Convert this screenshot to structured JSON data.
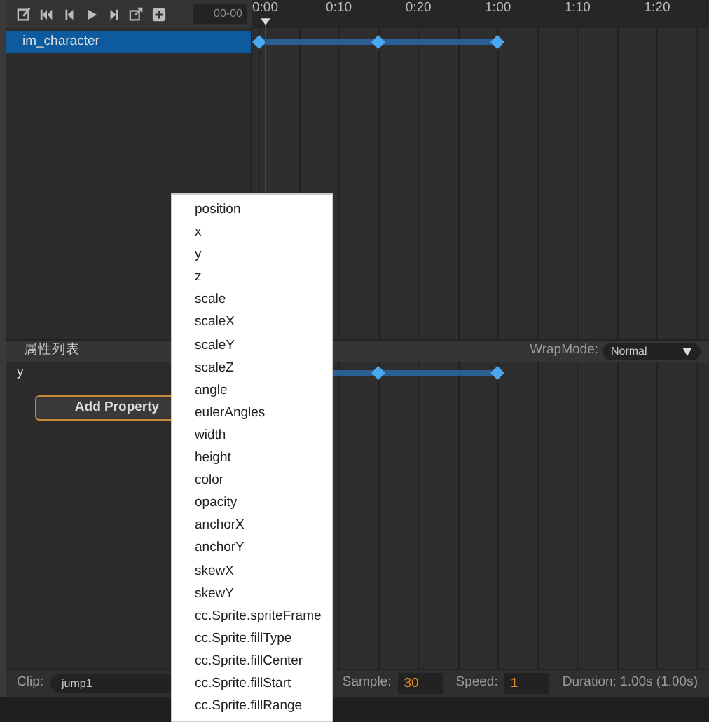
{
  "toolbar": {
    "time_field": "00-00"
  },
  "ruler": {
    "labels": [
      "0:00",
      "0:10",
      "0:20",
      "1:00",
      "1:10",
      "1:20"
    ]
  },
  "nodes": [
    {
      "name": "im_character",
      "selected": true
    }
  ],
  "property_panel": {
    "title": "属性列表",
    "wrap_mode_label": "WrapMode:",
    "wrap_mode_value": "Normal",
    "properties": [
      {
        "name": "y",
        "selected": false
      }
    ],
    "add_button": "Add Property"
  },
  "context_menu": {
    "items": [
      "position",
      "x",
      "y",
      "z",
      "scale",
      "scaleX",
      "scaleY",
      "scaleZ",
      "angle",
      "eulerAngles",
      "width",
      "height",
      "color",
      "opacity",
      "anchorX",
      "anchorY",
      "skewX",
      "skewY",
      "cc.Sprite.spriteFrame",
      "cc.Sprite.fillType",
      "cc.Sprite.fillCenter",
      "cc.Sprite.fillStart",
      "cc.Sprite.fillRange"
    ]
  },
  "bottom_bar": {
    "clip_label": "Clip:",
    "clip_value": "jump1",
    "sample_label": "Sample:",
    "sample_value": "30",
    "speed_label": "Speed:",
    "speed_value": "1",
    "duration": "Duration: 1.00s (1.00s)"
  }
}
